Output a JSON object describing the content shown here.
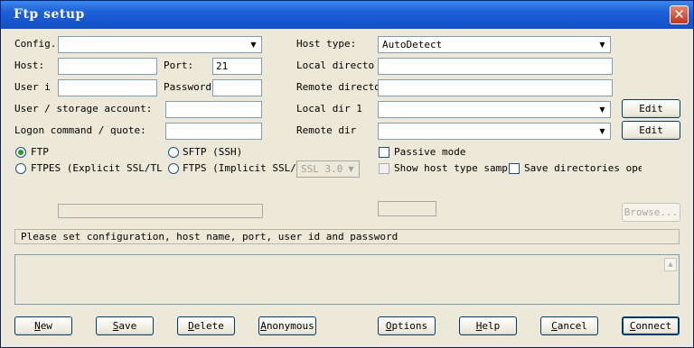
{
  "window": {
    "title": "Ftp setup",
    "close_glyph": "✕"
  },
  "left": {
    "config_label": "Config.",
    "config_value": "",
    "host_label": "Host:",
    "host_value": "",
    "port_label": "Port:",
    "port_value": "21",
    "user_label": "User i",
    "user_value": "",
    "password_label": "Password",
    "password_value": "",
    "account_label": "User / storage account:",
    "account_value": "",
    "logon_label": "Logon command / quote:",
    "logon_value": ""
  },
  "right": {
    "host_type_label": "Host type:",
    "host_type_value": "AutoDetect",
    "local_dir_label": "Local directo",
    "local_dir_value": "",
    "remote_dir_label": "Remote directo",
    "remote_dir_value": "",
    "local_dir1_label": "Local dir 1",
    "local_dir1_value": "",
    "remote_dir2_label": "Remote dir",
    "remote_dir2_value": "",
    "edit_label": "Edit"
  },
  "protocol": {
    "ftp": "FTP",
    "sftp": "SFTP (SSH)",
    "ftpes": "FTPES (Explicit SSL/TL",
    "ftps": "FTPS (Implicit SSL/T",
    "ssl_version": "SSL 3.0",
    "selected": "ftp"
  },
  "options": {
    "passive_mode": "Passive mode",
    "show_host_type": "Show host type samp",
    "save_directories": "Save directories opene"
  },
  "browse_label": "Browse...",
  "status_text": "Please set configuration, host name, port, user id and password",
  "buttons": {
    "new": "New",
    "new_key": "N",
    "new_rest": "ew",
    "save": "Save",
    "save_key": "S",
    "save_rest": "ave",
    "delete": "Delete",
    "delete_key": "D",
    "delete_rest": "elete",
    "anonymous": "Anonymous",
    "anonymous_key": "A",
    "anonymous_rest": "nonymous",
    "options": "Options",
    "options_key": "O",
    "options_rest": "ptions",
    "help": "Help",
    "help_key": "H",
    "help_rest": "elp",
    "cancel": "Cancel",
    "cancel_key": "C",
    "cancel_rest": "ancel",
    "connect": "Connect",
    "connect_key": "C",
    "connect_rest": "onnect"
  },
  "icons": {
    "dropdown": "dropdown-arrow-icon",
    "close": "close-icon"
  },
  "colors": {
    "titlebar": "#1c5fd6",
    "close": "#c4341a",
    "radio_dot": "#21a121"
  }
}
